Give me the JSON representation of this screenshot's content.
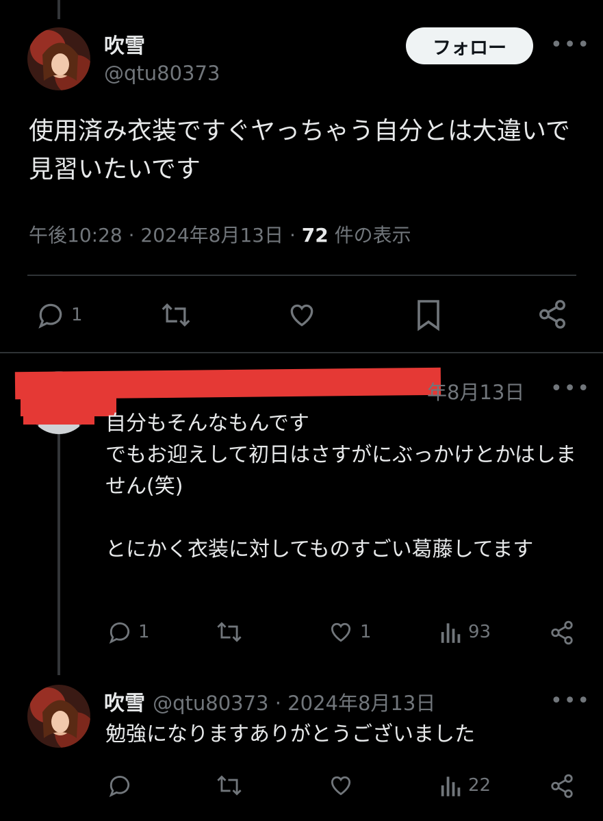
{
  "main_post": {
    "name": "吹雪",
    "handle": "@qtu80373",
    "follow_label": "フォロー",
    "text": "使用済み衣装ですぐヤっちゃう自分とは大違いで見習いたいです",
    "time": "午後10:28 · 2024年8月13日 · ",
    "views_count": "72",
    "views_label": " 件の表示",
    "reply_count": "1"
  },
  "reply1": {
    "date_visible": "年8月13日",
    "text": "自分もそんなもんです\nでもお迎えして初日はさすがにぶっかけとかはしません(笑)\n\nとにかく衣装に対してものすごい葛藤してます",
    "reply_count": "1",
    "like_count": "1",
    "view_count": "93"
  },
  "reply2": {
    "name": "吹雪",
    "handle": "@qtu80373",
    "date": " · 2024年8月13日",
    "text": "勉強になりますありがとうございました",
    "view_count": "22"
  },
  "colors": {
    "background": "#000000",
    "text": "#e7e9ea",
    "muted": "#71767b",
    "divider": "#2f3336",
    "redaction": "#e53935"
  }
}
